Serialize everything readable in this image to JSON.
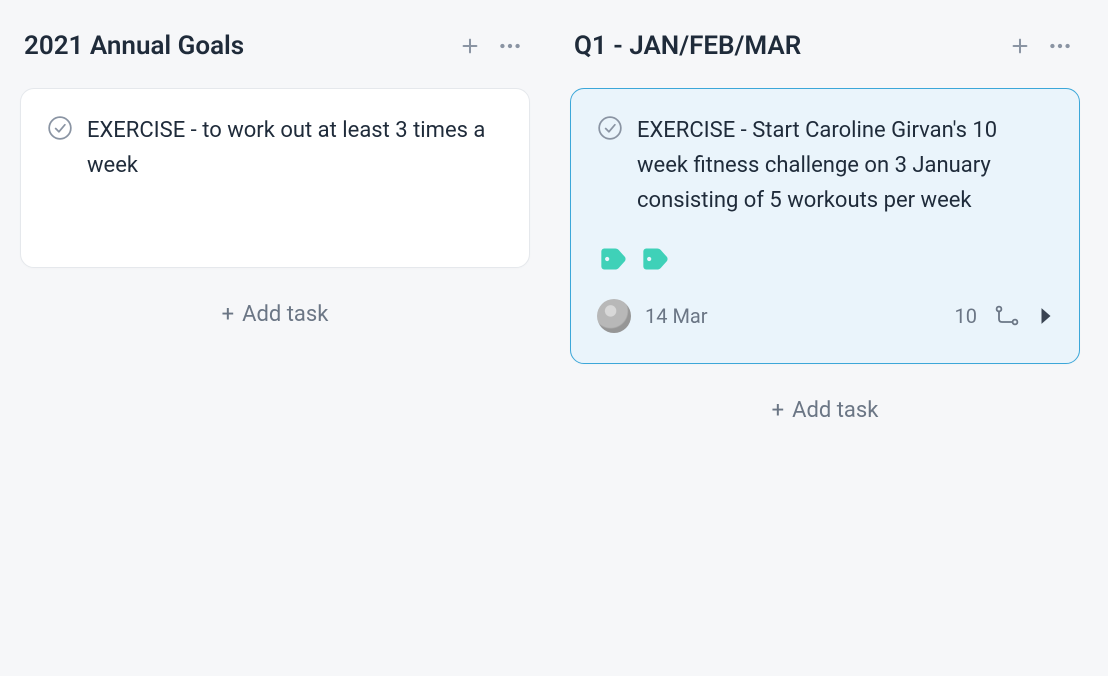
{
  "columns": [
    {
      "title": "2021 Annual Goals",
      "add_task_label": "Add task",
      "cards": [
        {
          "title": "EXERCISE - to work out at least 3 times a week",
          "selected": false,
          "tall": true,
          "tags": [],
          "due": null,
          "subtask_count": null
        }
      ]
    },
    {
      "title": "Q1 - JAN/FEB/MAR",
      "add_task_label": "Add task",
      "cards": [
        {
          "title": "EXERCISE - Start Caroline Girvan's 10 week fitness challenge on 3 January consisting of 5 workouts per week",
          "selected": true,
          "tall": false,
          "due": "14 Mar",
          "subtask_count": "10",
          "tag_count": 2
        }
      ]
    }
  ],
  "colors": {
    "tag": "#3fd1b8",
    "selection_border": "#3ca7d9"
  }
}
